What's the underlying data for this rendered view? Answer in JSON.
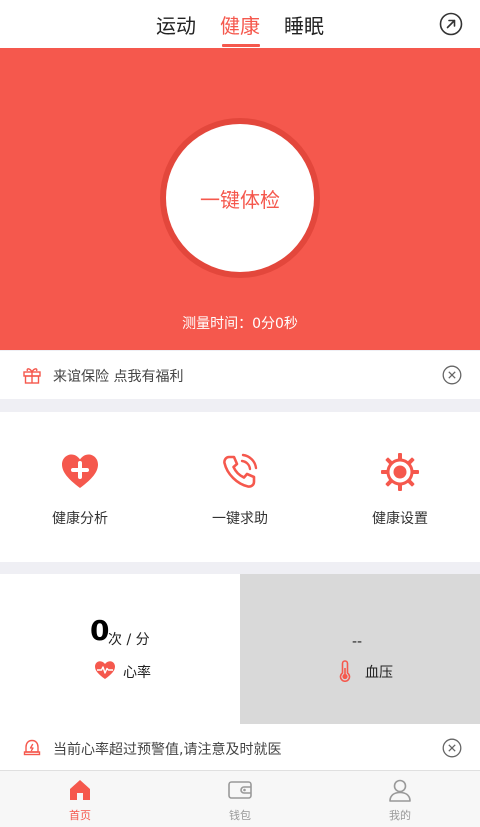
{
  "tabs": [
    {
      "label": "运动",
      "active": false
    },
    {
      "label": "健康",
      "active": true
    },
    {
      "label": "睡眠",
      "active": false
    }
  ],
  "top_right_icon": "share-arrow-icon",
  "hero": {
    "check_button": "一键体检",
    "measure_time": "测量时间：0分0秒"
  },
  "insurance_banner": {
    "icon": "gift-icon",
    "text": "来谊保险 点我有福利"
  },
  "features": [
    {
      "label": "健康分析",
      "icon": "heart-plus-icon"
    },
    {
      "label": "一键求助",
      "icon": "phone-call-icon"
    },
    {
      "label": "健康设置",
      "icon": "gear-icon"
    }
  ],
  "heart_rate": {
    "value": "0",
    "unit": "次 / 分",
    "label": "心率"
  },
  "blood_pressure": {
    "value": "--",
    "label": "血压"
  },
  "alert_banner": {
    "icon": "alarm-bell-icon",
    "text": "当前心率超过预警值,请注意及时就医"
  },
  "bottom_nav": [
    {
      "label": "首页",
      "icon": "home-icon",
      "active": true
    },
    {
      "label": "钱包",
      "icon": "wallet-icon",
      "active": false
    },
    {
      "label": "我的",
      "icon": "user-icon",
      "active": false
    }
  ],
  "colors": {
    "accent": "#f5584d",
    "background": "#efeff4",
    "bp_panel": "#d9d9d9"
  }
}
